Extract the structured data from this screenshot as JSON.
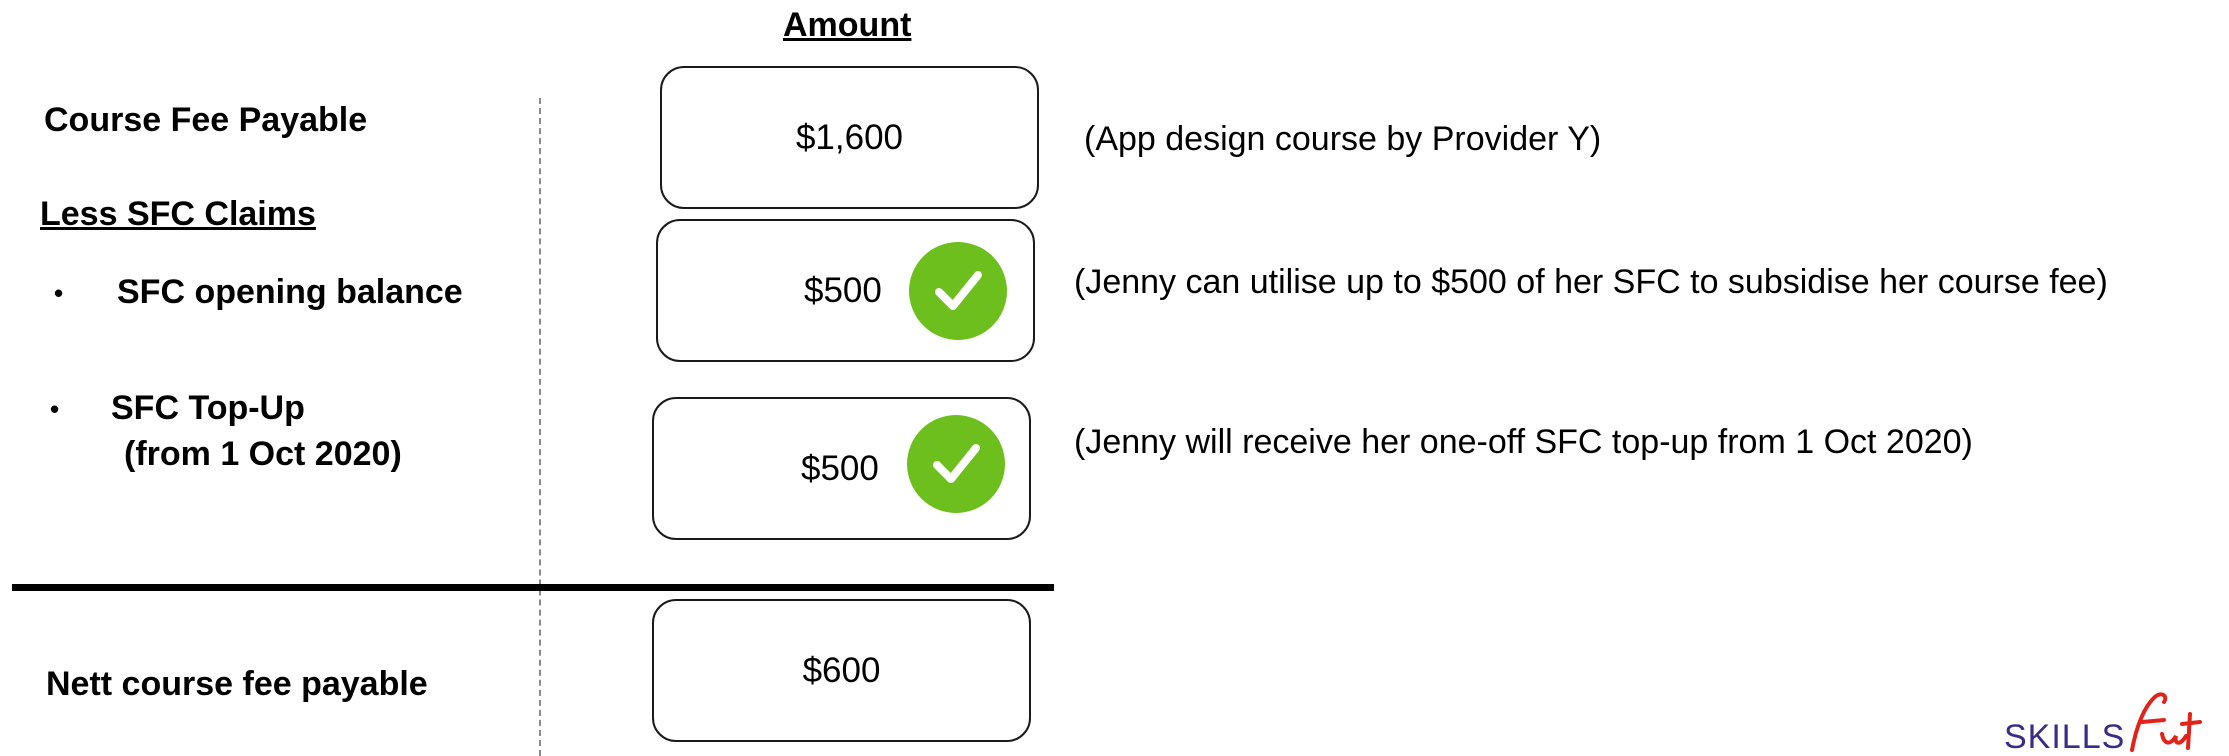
{
  "header": {
    "amount": "Amount"
  },
  "rows": {
    "course_fee": {
      "label": "Course Fee Payable",
      "amount": "$1,600",
      "note": "(App design course by Provider Y)"
    },
    "less_heading": "Less SFC Claims",
    "bullet_symbol": "•",
    "opening_balance": {
      "label": "SFC opening balance",
      "amount": "$500",
      "note": "(Jenny can utilise up to $500 of her SFC to subsidise her course fee)"
    },
    "top_up": {
      "label_line1": "SFC Top-Up",
      "label_line2": "(from 1 Oct 2020)",
      "amount": "$500",
      "note": "(Jenny will receive her one-off SFC top-up from 1 Oct 2020)"
    },
    "nett": {
      "label": "Nett course fee payable",
      "amount": "$600"
    }
  },
  "logo": {
    "text": "SKILLSFuture"
  },
  "colors": {
    "check_green": "#6cbf1d",
    "logo_purple": "#3b2a86",
    "logo_red": "#e2231a"
  },
  "icons": {
    "check": "check-circle-icon"
  }
}
